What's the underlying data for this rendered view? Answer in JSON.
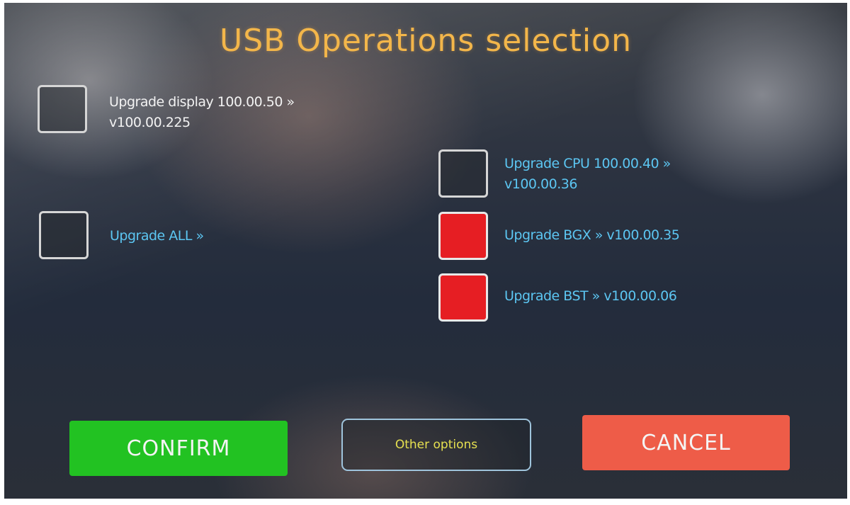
{
  "screen": {
    "title": "USB Operations selection"
  },
  "options": {
    "upgrade_display": {
      "line1": "Upgrade display 100.00.50 »",
      "line2": "v100.00.225",
      "checked": false
    },
    "upgrade_cpu": {
      "line1": "Upgrade CPU 100.00.40 »",
      "line2": "v100.00.36",
      "checked": false
    },
    "upgrade_all": {
      "label": "Upgrade ALL »",
      "checked": false
    },
    "upgrade_bgx": {
      "label": "Upgrade BGX » v100.00.35",
      "checked": true
    },
    "upgrade_bst": {
      "label": "Upgrade BST » v100.00.06",
      "checked": true
    }
  },
  "buttons": {
    "confirm": "CONFIRM",
    "other_options": "Other options",
    "cancel": "CANCEL"
  },
  "colors": {
    "title": "#f3b64a",
    "checked_box": "#e61e23",
    "confirm_button": "#22c222",
    "cancel_button": "#ee5c48",
    "other_options_text": "#e6e050",
    "blue_label": "#5cc6f2"
  }
}
